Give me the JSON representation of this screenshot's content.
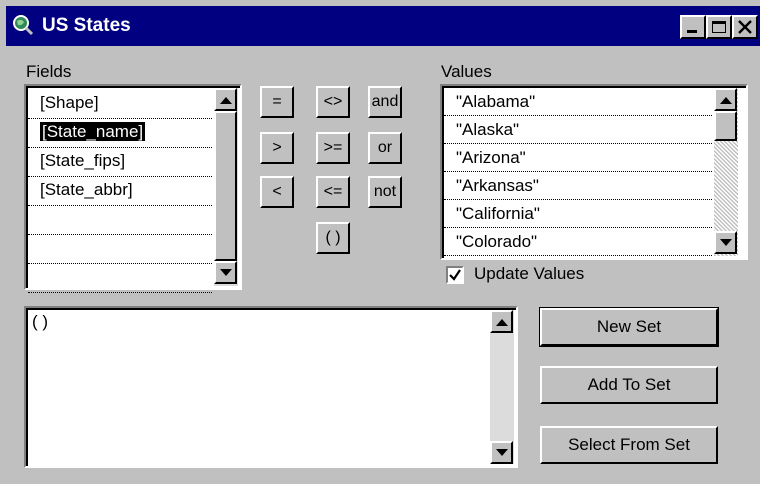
{
  "window": {
    "title": "US States",
    "icon": "globe-magnifier-icon"
  },
  "fields": {
    "label": "Fields",
    "items": [
      "[Shape]",
      "[State_name]",
      "[State_fips]",
      "[State_abbr]",
      "",
      "",
      ""
    ],
    "selected_index": 1
  },
  "operators": [
    "=",
    "<>",
    "and",
    ">",
    ">=",
    "or",
    "<",
    "<=",
    "not",
    "( )"
  ],
  "values": {
    "label": "Values",
    "items": [
      "\"Alabama\"",
      "\"Alaska\"",
      "\"Arizona\"",
      "\"Arkansas\"",
      "\"California\"",
      "\"Colorado\""
    ]
  },
  "update_values": {
    "label": "Update Values",
    "checked": true
  },
  "expression": {
    "text": "( )"
  },
  "buttons": {
    "new_set": "New Set",
    "add_to_set": "Add To Set",
    "select_from_set": "Select From Set"
  }
}
